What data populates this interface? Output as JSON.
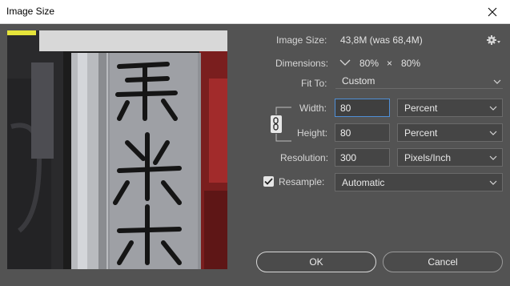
{
  "window": {
    "title": "Image Size",
    "close_icon": "close-icon"
  },
  "info": {
    "image_size_label": "Image Size:",
    "image_size_value": "43,8M (was 68,4M)",
    "settings_icon": "gear-icon",
    "dimensions_label": "Dimensions:",
    "dimensions_width": "80%",
    "dimensions_sep": "×",
    "dimensions_height": "80%"
  },
  "fit_to": {
    "label": "Fit To:",
    "value": "Custom"
  },
  "width": {
    "label": "Width:",
    "value": "80",
    "unit": "Percent"
  },
  "height": {
    "label": "Height:",
    "value": "80",
    "unit": "Percent"
  },
  "resolution": {
    "label": "Resolution:",
    "value": "300",
    "unit": "Pixels/Inch"
  },
  "resample": {
    "label": "Resample:",
    "checked": true,
    "value": "Automatic"
  },
  "buttons": {
    "ok": "OK",
    "cancel": "Cancel"
  },
  "colors": {
    "dialog_bg": "#535353",
    "field_bg": "#454545",
    "focus_border": "#4f8fd6"
  }
}
